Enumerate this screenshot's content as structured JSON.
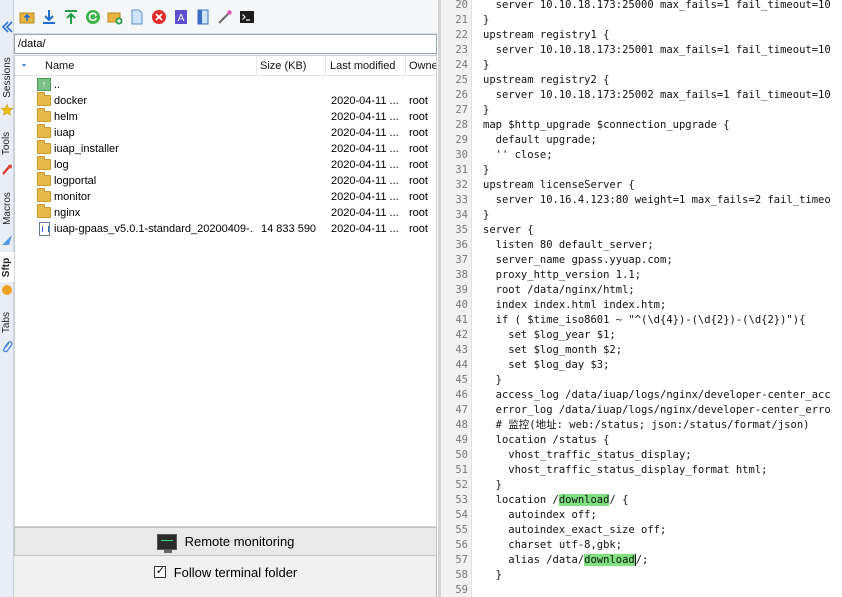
{
  "left_strip": {
    "tabs": [
      {
        "label": "Sessions"
      },
      {
        "label": "Tools"
      },
      {
        "label": "Macros"
      },
      {
        "label": "Sftp"
      },
      {
        "label": "Tabs"
      }
    ]
  },
  "toolbar": {
    "icons": [
      "up-folder-icon",
      "download-icon",
      "upload-icon",
      "refresh-icon",
      "new-folder-icon",
      "new-file-icon",
      "delete-icon",
      "rename-icon",
      "permissions-icon",
      "edit-icon",
      "terminal-icon"
    ]
  },
  "path": {
    "value": "/data/"
  },
  "columns": {
    "name": "Name",
    "size": "Size (KB)",
    "modified": "Last modified",
    "owner": "Owner"
  },
  "files": [
    {
      "name": "..",
      "size": "",
      "modified": "",
      "owner": "",
      "type": "up"
    },
    {
      "name": "docker",
      "size": "",
      "modified": "2020-04-11 ...",
      "owner": "root",
      "type": "folder"
    },
    {
      "name": "helm",
      "size": "",
      "modified": "2020-04-11 ...",
      "owner": "root",
      "type": "folder"
    },
    {
      "name": "iuap",
      "size": "",
      "modified": "2020-04-11 ...",
      "owner": "root",
      "type": "folder"
    },
    {
      "name": "iuap_installer",
      "size": "",
      "modified": "2020-04-11 ...",
      "owner": "root",
      "type": "folder"
    },
    {
      "name": "log",
      "size": "",
      "modified": "2020-04-11 ...",
      "owner": "root",
      "type": "folder"
    },
    {
      "name": "logportal",
      "size": "",
      "modified": "2020-04-11 ...",
      "owner": "root",
      "type": "folder"
    },
    {
      "name": "monitor",
      "size": "",
      "modified": "2020-04-11 ...",
      "owner": "root",
      "type": "folder"
    },
    {
      "name": "nginx",
      "size": "",
      "modified": "2020-04-11 ...",
      "owner": "root",
      "type": "folder"
    },
    {
      "name": "iuap-gpaas_v5.0.1-standard_20200409-...",
      "size": "14 833 590",
      "modified": "2020-04-11 ...",
      "owner": "root",
      "type": "file"
    }
  ],
  "bottom": {
    "monitor_label": "Remote monitoring",
    "follow_label": "Follow terminal folder",
    "follow_checked": true
  },
  "editor": {
    "highlight_color": "#7fe07f",
    "lines": [
      {
        "n": "20",
        "text": "  server 10.10.18.173:25000 max_fails=1 fail_timeout=10"
      },
      {
        "n": "21",
        "text": "}"
      },
      {
        "n": "22",
        "text": "upstream registry1 {"
      },
      {
        "n": "23",
        "text": "  server 10.10.18.173:25001 max_fails=1 fail_timeout=10"
      },
      {
        "n": "24",
        "text": "}"
      },
      {
        "n": "25",
        "text": "upstream registry2 {"
      },
      {
        "n": "26",
        "text": "  server 10.10.18.173:25002 max_fails=1 fail_timeout=10"
      },
      {
        "n": "27",
        "text": "}"
      },
      {
        "n": "28",
        "text": "map $http_upgrade $connection_upgrade {"
      },
      {
        "n": "29",
        "text": "  default upgrade;"
      },
      {
        "n": "30",
        "text": "  '' close;"
      },
      {
        "n": "31",
        "text": "}"
      },
      {
        "n": "32",
        "text": "upstream licenseServer {"
      },
      {
        "n": "33",
        "text": "  server 10.16.4.123:80 weight=1 max_fails=2 fail_timeo"
      },
      {
        "n": "34",
        "text": "}"
      },
      {
        "n": "35",
        "text": "server {"
      },
      {
        "n": "36",
        "text": "  listen 80 default_server;"
      },
      {
        "n": "37",
        "text": "  server_name gpass.yyuap.com;"
      },
      {
        "n": "38",
        "text": "  proxy_http_version 1.1;"
      },
      {
        "n": "39",
        "text": "  root /data/nginx/html;"
      },
      {
        "n": "40",
        "text": "  index index.html index.htm;"
      },
      {
        "n": "41",
        "text": "  if ( $time_iso8601 ~ \"^(\\d{4})-(\\d{2})-(\\d{2})\"){"
      },
      {
        "n": "42",
        "text": "    set $log_year $1;"
      },
      {
        "n": "43",
        "text": "    set $log_month $2;"
      },
      {
        "n": "44",
        "text": "    set $log_day $3;"
      },
      {
        "n": "45",
        "text": "  }"
      },
      {
        "n": "46",
        "text": "  access_log /data/iuap/logs/nginx/developer-center_acc"
      },
      {
        "n": "47",
        "text": "  error_log /data/iuap/logs/nginx/developer-center_erro"
      },
      {
        "n": "48",
        "text": "  # 监控(地址: web:/status; json:/status/format/json)"
      },
      {
        "n": "49",
        "text": "  location /status {"
      },
      {
        "n": "50",
        "text": "    vhost_traffic_status_display;"
      },
      {
        "n": "51",
        "text": "    vhost_traffic_status_display_format html;"
      },
      {
        "n": "52",
        "text": "  }"
      },
      {
        "n": "53",
        "pre": "  location /",
        "hl": "download",
        "post": "/ {"
      },
      {
        "n": "54",
        "text": "    autoindex off;"
      },
      {
        "n": "55",
        "text": "    autoindex_exact_size off;"
      },
      {
        "n": "56",
        "text": "    charset utf-8,gbk;"
      },
      {
        "n": "57",
        "pre": "    alias /data/",
        "hl": "download",
        "post": "/;"
      },
      {
        "n": "58",
        "text": "  }"
      },
      {
        "n": "59",
        "text": ""
      }
    ]
  }
}
